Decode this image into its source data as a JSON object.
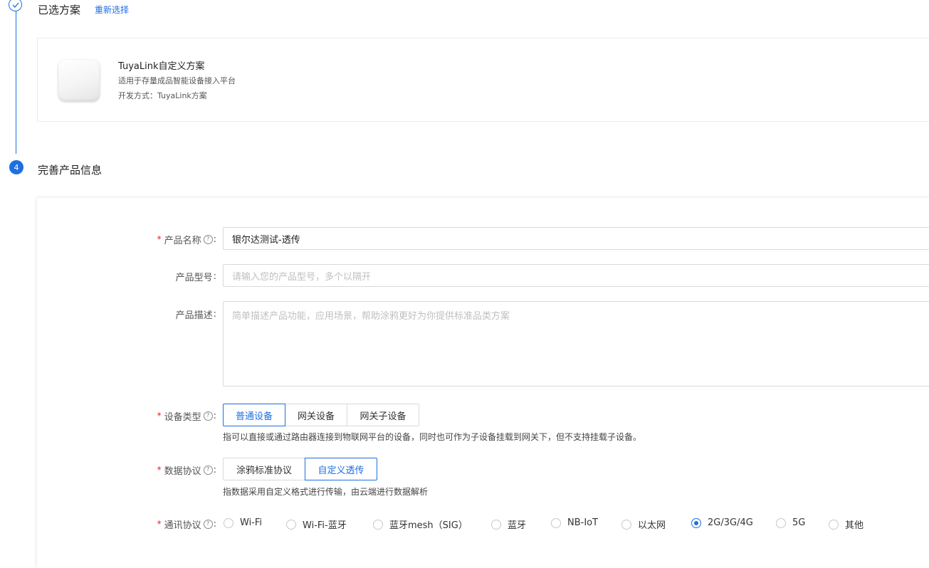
{
  "steps": {
    "selected": {
      "title": "已选方案",
      "reselect_label": "重新选择"
    },
    "current": {
      "number": "4",
      "title": "完善产品信息"
    }
  },
  "scheme": {
    "name": "TuyaLink自定义方案",
    "description": "适用于存量成品智能设备接入平台",
    "dev_method": "开发方式：TuyaLink方案"
  },
  "form": {
    "product_name": {
      "label": "产品名称",
      "required": true,
      "value": "银尔达测试-透传"
    },
    "product_model": {
      "label": "产品型号",
      "placeholder": "请输入您的产品型号，多个以隔开"
    },
    "product_desc": {
      "label": "产品描述",
      "placeholder": "简单描述产品功能，应用场景，帮助涂鸦更好为你提供标准品类方案"
    },
    "device_type": {
      "label": "设备类型",
      "required": true,
      "options": [
        "普通设备",
        "网关设备",
        "网关子设备"
      ],
      "selected": "普通设备",
      "help": "指可以直接或通过路由器连接到物联网平台的设备，同时也可作为子设备挂载到网关下，但不支持挂载子设备。"
    },
    "data_protocol": {
      "label": "数据协议",
      "required": true,
      "options": [
        "涂鸦标准协议",
        "自定义透传"
      ],
      "selected": "自定义透传",
      "help": "指数据采用自定义格式进行传输，由云端进行数据解析"
    },
    "comm_protocol": {
      "label": "通讯协议",
      "required": true,
      "options": [
        "Wi-Fi",
        "Wi-Fi-蓝牙",
        "蓝牙mesh（SIG）",
        "蓝牙",
        "NB-IoT",
        "以太网",
        "2G/3G/4G",
        "5G",
        "其他"
      ],
      "selected": "2G/3G/4G"
    }
  },
  "colors": {
    "primary": "#1e6fe0",
    "required": "#e02020",
    "border": "#d9d9d9"
  },
  "icons": {
    "step_done": "check-circle-icon",
    "help": "question-circle-icon"
  }
}
